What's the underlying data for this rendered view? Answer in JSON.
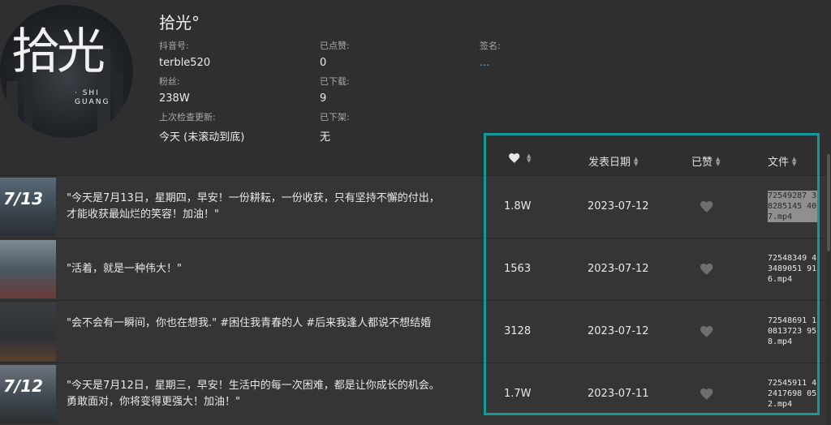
{
  "profile": {
    "avatar_text_big": "拾光",
    "avatar_text_small": "· SHI\nGUANG",
    "name": "拾光°",
    "douyin_id_label": "抖音号:",
    "douyin_id": "terble520",
    "fans_label": "粉丝:",
    "fans": "238W",
    "last_check_label": "上次检查更新:",
    "last_check": "今天 (未滚动到底)",
    "liked_label": "已点赞:",
    "liked": "0",
    "downloaded_label": "已下载:",
    "downloaded": "9",
    "removed_label": "已下架:",
    "removed": "无",
    "signature_label": "签名:",
    "signature": "..."
  },
  "table": {
    "columns": {
      "likes": "",
      "date": "发表日期",
      "liked": "已赞",
      "file": "文件"
    },
    "rows": [
      {
        "thumb_label": "7/13",
        "desc": "\"今天是7月13日，星期四，早安！一份耕耘，一份收获，只有坚持不懈的付出，才能收获最灿烂的笑容！加油！\"",
        "likes": "1.8W",
        "date": "2023-07-12",
        "file": "72549287 38285145 407.mp4"
      },
      {
        "thumb_label": "",
        "desc": "\"活着，就是一种伟大！\"",
        "likes": "1563",
        "date": "2023-07-12",
        "file": "72548349 43489051 916.mp4"
      },
      {
        "thumb_label": "",
        "desc": "\"会不会有一瞬间，你也在想我.\" #困住我青春的人 #后来我逢人都说不想结婚",
        "likes": "3128",
        "date": "2023-07-12",
        "file": "72548691 10813723 958.mp4"
      },
      {
        "thumb_label": "7/12",
        "desc": "\"今天是7月12日，星期三，早安！生活中的每一次困难，都是让你成长的机会。勇敢面对，你将变得更强大！加油！\"",
        "likes": "1.7W",
        "date": "2023-07-11",
        "file": "72545911 42417698 052.mp4"
      }
    ]
  },
  "colors": {
    "highlight_border": "#14999a",
    "link": "#5fa8ff"
  }
}
